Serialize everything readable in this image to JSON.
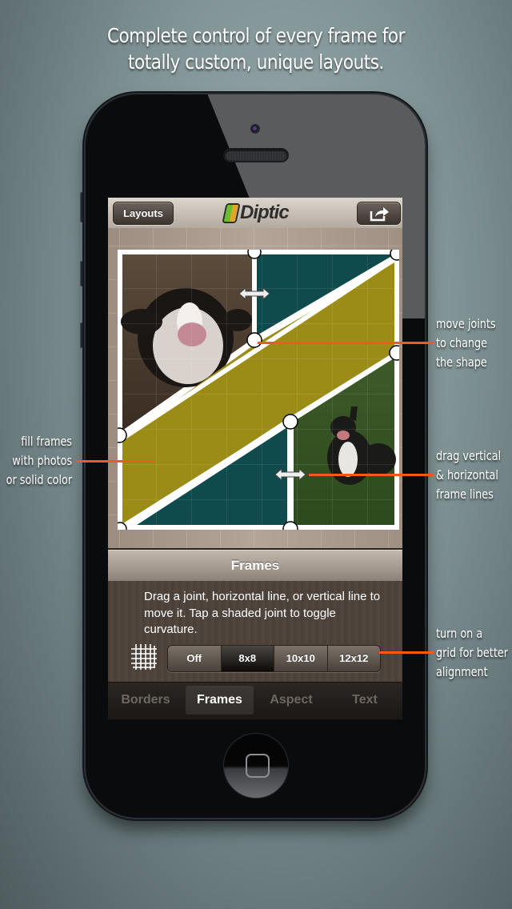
{
  "headline": {
    "line1": "Complete control of every frame for",
    "line2": "totally custom, unique layouts."
  },
  "app": {
    "navbar": {
      "layouts_button": "Layouts",
      "logo_text": "Diptic",
      "logo_colors": [
        "#6bbf2f",
        "#e0a62a"
      ],
      "share_icon": "share-arrow-icon"
    },
    "collage": {
      "frame_colors": {
        "teal": "#0f4a4c",
        "olive": "#9a8c16",
        "border": "#ffffff"
      },
      "frames": [
        {
          "name": "top-left",
          "fill": "photo",
          "photo": "dog licking lips (close-up)"
        },
        {
          "name": "top-right",
          "fill": "solid",
          "color": "#0f4a4c"
        },
        {
          "name": "middle-band",
          "fill": "solid",
          "color": "#9a8c16"
        },
        {
          "name": "bottom-left",
          "fill": "solid",
          "color": "#0f4a4c"
        },
        {
          "name": "bottom-right",
          "fill": "photo",
          "photo": "dog standing on grass"
        }
      ],
      "handles": [
        "horizontal-resize-arrow",
        "horizontal-resize-arrow"
      ]
    },
    "panel": {
      "title": "Frames",
      "help_text": "Drag a joint, horizontal line, or vertical line to move it. Tap a shaded joint to toggle curvature.",
      "grid_icon": "grid-icon",
      "grid_options": [
        "Off",
        "8x8",
        "10x10",
        "12x12"
      ],
      "grid_selected": "8x8"
    },
    "tabs": [
      {
        "label": "Borders",
        "active": false
      },
      {
        "label": "Frames",
        "active": true
      },
      {
        "label": "Aspect",
        "active": false
      },
      {
        "label": "Text",
        "active": false
      }
    ]
  },
  "callouts": {
    "fill": [
      "fill frames",
      "with photos",
      "or solid color"
    ],
    "joints": [
      "move joints",
      "to change",
      "the shape"
    ],
    "lines": [
      "drag vertical",
      "& horizontal",
      "frame lines"
    ],
    "grid": [
      "turn on a",
      "grid for better",
      "alignment"
    ],
    "accent_color": "#f05a1c"
  }
}
